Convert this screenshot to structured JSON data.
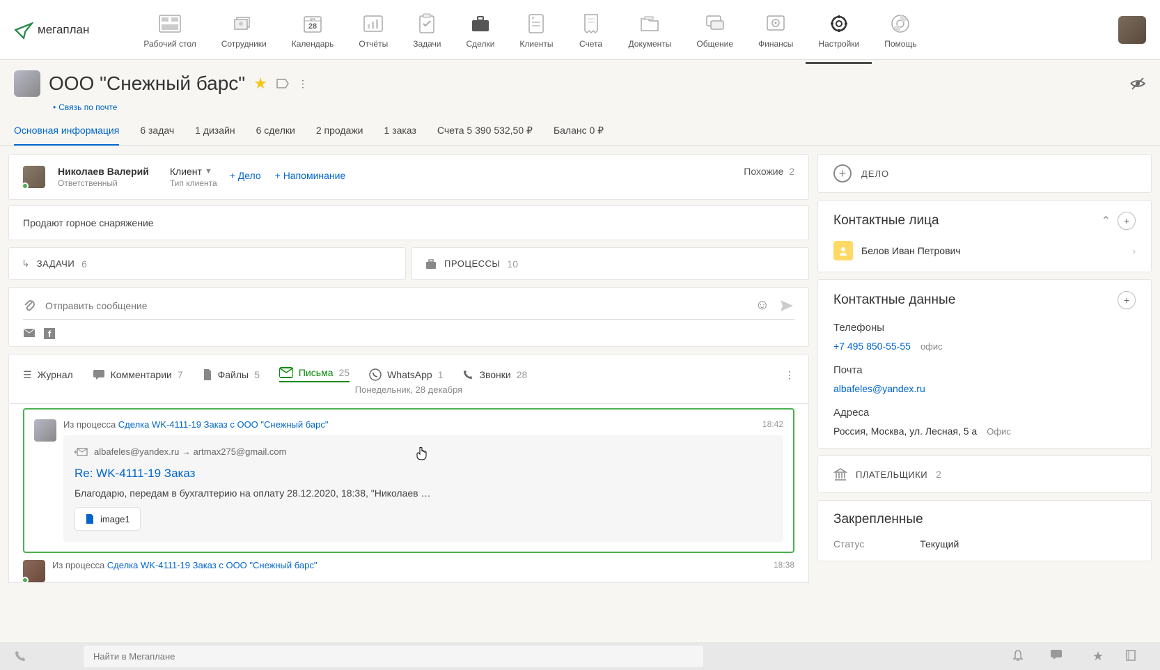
{
  "logo": "мегаплан",
  "nav": [
    {
      "label": "Рабочий стол"
    },
    {
      "label": "Сотрудники"
    },
    {
      "label": "Календарь",
      "badge": "28",
      "month": "дек"
    },
    {
      "label": "Отчёты"
    },
    {
      "label": "Задачи"
    },
    {
      "label": "Сделки"
    },
    {
      "label": "Клиенты"
    },
    {
      "label": "Счета"
    },
    {
      "label": "Документы"
    },
    {
      "label": "Общение"
    },
    {
      "label": "Финансы"
    },
    {
      "label": "Настройки"
    },
    {
      "label": "Помощь"
    }
  ],
  "client": {
    "title": "ООО \"Снежный барс\"",
    "sublink": "Связь по почте"
  },
  "tabs": [
    {
      "label": "Основная информация",
      "active": true
    },
    {
      "label": "6 задач"
    },
    {
      "label": "1 дизайн"
    },
    {
      "label": "6 сделки"
    },
    {
      "label": "2 продажи"
    },
    {
      "label": "1 заказ"
    },
    {
      "label": "Счета 5 390 532,50 ₽"
    },
    {
      "label": "Баланс 0 ₽"
    }
  ],
  "responsible": {
    "name": "Николаев Валерий",
    "role": "Ответственный"
  },
  "clientType": {
    "value": "Клиент",
    "label": "Тип клиента"
  },
  "addLinks": {
    "delo": "+ Дело",
    "reminder": "+ Напоминание"
  },
  "similar": {
    "label": "Похожие",
    "count": "2"
  },
  "description": "Продают горное снаряжение",
  "taskProc": {
    "tasks": {
      "label": "ЗАДАЧИ",
      "count": "6"
    },
    "processes": {
      "label": "ПРОЦЕССЫ",
      "count": "10"
    }
  },
  "messageInput": {
    "placeholder": "Отправить сообщение"
  },
  "filters": [
    {
      "label": "Журнал"
    },
    {
      "label": "Комментарии",
      "count": "7"
    },
    {
      "label": "Файлы",
      "count": "5"
    },
    {
      "label": "Письма",
      "count": "25",
      "active": true
    },
    {
      "label": "WhatsApp",
      "count": "1"
    },
    {
      "label": "Звонки",
      "count": "28"
    }
  ],
  "dateLabel": "Понедельник, 28 декабря",
  "email1": {
    "fromPrefix": "Из процесса ",
    "fromLink": "Сделка WK-4111-19 Заказ с ООО \"Снежный барс\"",
    "time": "18:42",
    "addresses": "albafeles@yandex.ru → artmax275@gmail.com",
    "subject": "Re: WK-4111-19 Заказ",
    "body": "Благодарю, передам в бухгалтерию на оплату  28.12.2020, 18:38, \"Николаев …",
    "attachment": "image1"
  },
  "email2": {
    "fromPrefix": "Из процесса ",
    "fromLink": "Сделка WK-4111-19 Заказ с ООО \"Снежный барс\"",
    "time": "18:38"
  },
  "sidebar": {
    "delo": "ДЕЛО",
    "contacts": {
      "title": "Контактные лица",
      "person": "Белов Иван Петрович"
    },
    "contactData": {
      "title": "Контактные данные",
      "phones": {
        "label": "Телефоны",
        "value": "+7 495 850-55-55",
        "tag": "офис"
      },
      "email": {
        "label": "Почта",
        "value": "albafeles@yandex.ru"
      },
      "address": {
        "label": "Адреса",
        "value": "Россия, Москва, ул. Лесная, 5 а",
        "tag": "Офис"
      }
    },
    "payers": {
      "label": "ПЛАТЕЛЬЩИКИ",
      "count": "2"
    },
    "pinned": {
      "title": "Закрепленные",
      "status": {
        "label": "Статус",
        "value": "Текущий"
      }
    }
  },
  "search": {
    "placeholder": "Найти в Мегаплане"
  }
}
